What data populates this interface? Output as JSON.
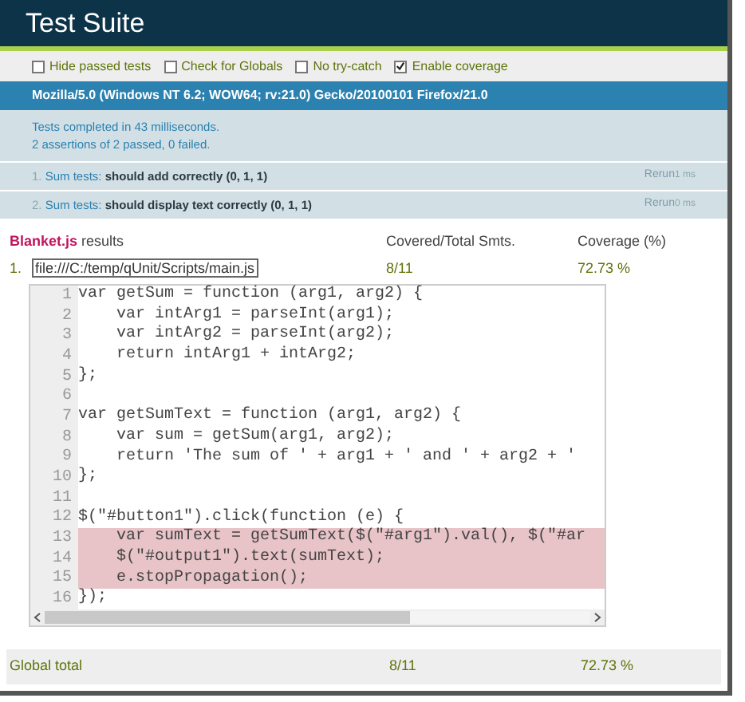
{
  "header": {
    "title": "Test Suite"
  },
  "options": [
    {
      "label": "Hide passed tests",
      "checked": false
    },
    {
      "label": "Check for Globals",
      "checked": false
    },
    {
      "label": "No try-catch",
      "checked": false
    },
    {
      "label": "Enable coverage",
      "checked": true
    }
  ],
  "user_agent": "Mozilla/5.0 (Windows NT 6.2; WOW64; rv:21.0) Gecko/20100101 Firefox/21.0",
  "summary": [
    "Tests completed in 43 milliseconds.",
    "2 assertions of 2 passed, 0 failed."
  ],
  "tests": [
    {
      "number": "1.",
      "module": "Sum tests:",
      "name": "should add correctly",
      "counts": "(0, 1, 1)",
      "rerun": "Rerun",
      "time": "1 ms"
    },
    {
      "number": "2.",
      "module": "Sum tests:",
      "name": "should display text correctly",
      "counts": "(0, 1, 1)",
      "rerun": "Rerun",
      "time": "0 ms"
    }
  ],
  "coverage": {
    "title_brand": "Blanket.js",
    "title_rest": "results",
    "columns": [
      "Covered/Total Smts.",
      "Coverage (%)"
    ],
    "files": [
      {
        "number": "1.",
        "path": "file:///C:/temp/qUnit/Scripts/main.js",
        "covered": "8/11",
        "percent": "72.73 %"
      }
    ],
    "code": [
      {
        "n": "1",
        "text": "var getSum = function (arg1, arg2) {",
        "covered": true
      },
      {
        "n": "2",
        "text": "    var intArg1 = parseInt(arg1);",
        "covered": true
      },
      {
        "n": "3",
        "text": "    var intArg2 = parseInt(arg2);",
        "covered": true
      },
      {
        "n": "4",
        "text": "    return intArg1 + intArg2;",
        "covered": true
      },
      {
        "n": "5",
        "text": "};",
        "covered": true
      },
      {
        "n": "6",
        "covered": true
      },
      {
        "n": "7",
        "text": "var getSumText = function (arg1, arg2) {",
        "covered": true
      },
      {
        "n": "8",
        "text": "    var sum = getSum(arg1, arg2);",
        "covered": true
      },
      {
        "n": "9",
        "text": "    return 'The sum of ' + arg1 + ' and ' + arg2 + '",
        "covered": true
      },
      {
        "n": "10",
        "text": "};",
        "covered": true
      },
      {
        "n": "11",
        "covered": true
      },
      {
        "n": "12",
        "text": "$(\"#button1\").click(function (e) {",
        "covered": true
      },
      {
        "n": "13",
        "text": "    var sumText = getSumText($(\"#arg1\").val(), $(\"#ar",
        "covered": false
      },
      {
        "n": "14",
        "text": "    $(\"#output1\").text(sumText);",
        "covered": false
      },
      {
        "n": "15",
        "text": "    e.stopPropagation();",
        "covered": false
      },
      {
        "n": "16",
        "text": "});",
        "covered": true
      }
    ],
    "total": {
      "label": "Global total",
      "covered": "8/11",
      "percent": "72.73 %"
    }
  }
}
